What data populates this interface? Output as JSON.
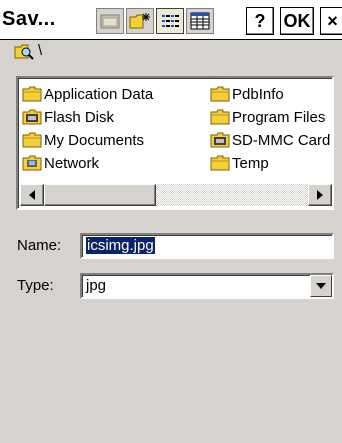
{
  "window": {
    "title": "Sav...",
    "help_label": "?",
    "ok_label": "OK",
    "close_label": "×"
  },
  "toolbar": {
    "buttons": [
      "up-folder-icon",
      "new-folder-icon",
      "list-view-icon",
      "details-view-icon"
    ]
  },
  "path": {
    "text": "\\"
  },
  "files": [
    {
      "label": "Application Data",
      "icon": "folder-icon"
    },
    {
      "label": "Flash Disk",
      "icon": "storage-card-icon"
    },
    {
      "label": "My Documents",
      "icon": "folder-icon"
    },
    {
      "label": "Network",
      "icon": "network-icon"
    },
    {
      "label": "PdbInfo",
      "icon": "folder-icon"
    },
    {
      "label": "Program Files",
      "icon": "folder-icon"
    },
    {
      "label": "SD-MMC Card",
      "icon": "storage-card-icon"
    },
    {
      "label": "Temp",
      "icon": "folder-icon"
    }
  ],
  "form": {
    "name_label": "Name:",
    "name_value": "icsimg.jpg",
    "type_label": "Type:",
    "type_value": "jpg"
  },
  "colors": {
    "dialog_bg": "#d6d3ce",
    "selection": "#0a246a",
    "folder": "#f4cf3a"
  }
}
